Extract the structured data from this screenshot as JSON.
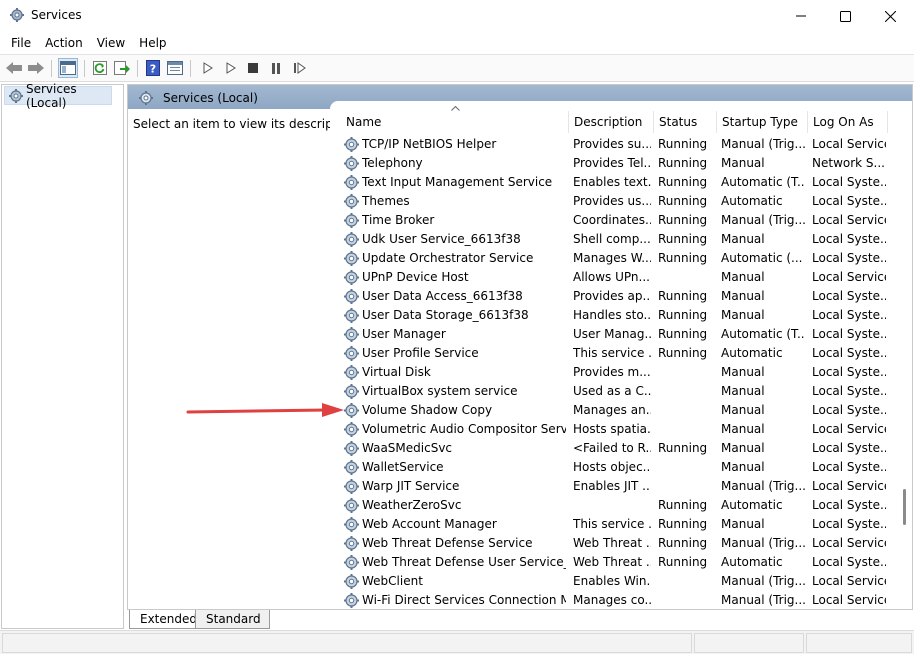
{
  "window": {
    "title": "Services",
    "minimize_icon": "minimize-icon",
    "maximize_icon": "maximize-icon",
    "close_icon": "close-icon"
  },
  "menu": [
    "File",
    "Action",
    "View",
    "Help"
  ],
  "toolbar": {
    "icons": [
      "back-icon",
      "forward-icon",
      "show-hide-console-tree-icon",
      "refresh-icon",
      "export-list-icon",
      "help-icon",
      "properties-icon",
      "start-service-icon",
      "start-service-alt-icon",
      "stop-service-icon",
      "pause-service-icon",
      "restart-service-icon"
    ]
  },
  "tree": {
    "item": "Services (Local)"
  },
  "panel": {
    "header": "Services (Local)",
    "description_hint": "Select an item to view its description."
  },
  "columns": {
    "name": "Name",
    "description": "Description",
    "status": "Status",
    "startup": "Startup Type",
    "logon": "Log On As"
  },
  "services": [
    {
      "name": "TCP/IP NetBIOS Helper",
      "description": "Provides su...",
      "status": "Running",
      "startup": "Manual (Trig...",
      "logon": "Local Service"
    },
    {
      "name": "Telephony",
      "description": "Provides Tel...",
      "status": "Running",
      "startup": "Manual",
      "logon": "Network S..."
    },
    {
      "name": "Text Input Management Service",
      "description": "Enables text...",
      "status": "Running",
      "startup": "Automatic (T...",
      "logon": "Local Syste..."
    },
    {
      "name": "Themes",
      "description": "Provides us...",
      "status": "Running",
      "startup": "Automatic",
      "logon": "Local Syste..."
    },
    {
      "name": "Time Broker",
      "description": "Coordinates...",
      "status": "Running",
      "startup": "Manual (Trig...",
      "logon": "Local Service"
    },
    {
      "name": "Udk User Service_6613f38",
      "description": "Shell comp...",
      "status": "Running",
      "startup": "Manual",
      "logon": "Local Syste..."
    },
    {
      "name": "Update Orchestrator Service",
      "description": "Manages W...",
      "status": "Running",
      "startup": "Automatic (...",
      "logon": "Local Syste..."
    },
    {
      "name": "UPnP Device Host",
      "description": "Allows UPn...",
      "status": "",
      "startup": "Manual",
      "logon": "Local Service"
    },
    {
      "name": "User Data Access_6613f38",
      "description": "Provides ap...",
      "status": "Running",
      "startup": "Manual",
      "logon": "Local Syste..."
    },
    {
      "name": "User Data Storage_6613f38",
      "description": "Handles sto...",
      "status": "Running",
      "startup": "Manual",
      "logon": "Local Syste..."
    },
    {
      "name": "User Manager",
      "description": "User Manag...",
      "status": "Running",
      "startup": "Automatic (T...",
      "logon": "Local Syste..."
    },
    {
      "name": "User Profile Service",
      "description": "This service ...",
      "status": "Running",
      "startup": "Automatic",
      "logon": "Local Syste..."
    },
    {
      "name": "Virtual Disk",
      "description": "Provides m...",
      "status": "",
      "startup": "Manual",
      "logon": "Local Syste..."
    },
    {
      "name": "VirtualBox system service",
      "description": "Used as a C...",
      "status": "",
      "startup": "Manual",
      "logon": "Local Syste..."
    },
    {
      "name": "Volume Shadow Copy",
      "description": "Manages an...",
      "status": "",
      "startup": "Manual",
      "logon": "Local Syste..."
    },
    {
      "name": "Volumetric Audio Compositor Service",
      "description": "Hosts spatia...",
      "status": "",
      "startup": "Manual",
      "logon": "Local Service"
    },
    {
      "name": "WaaSMedicSvc",
      "description": "<Failed to R...",
      "status": "Running",
      "startup": "Manual",
      "logon": "Local Syste..."
    },
    {
      "name": "WalletService",
      "description": "Hosts objec...",
      "status": "",
      "startup": "Manual",
      "logon": "Local Syste..."
    },
    {
      "name": "Warp JIT Service",
      "description": "Enables JIT ...",
      "status": "",
      "startup": "Manual (Trig...",
      "logon": "Local Service"
    },
    {
      "name": "WeatherZeroSvc",
      "description": "",
      "status": "Running",
      "startup": "Automatic",
      "logon": "Local Syste..."
    },
    {
      "name": "Web Account Manager",
      "description": "This service ...",
      "status": "Running",
      "startup": "Manual",
      "logon": "Local Syste..."
    },
    {
      "name": "Web Threat Defense Service",
      "description": "Web Threat ...",
      "status": "Running",
      "startup": "Manual (Trig...",
      "logon": "Local Service"
    },
    {
      "name": "Web Threat Defense User Service_661...",
      "description": "Web Threat ...",
      "status": "Running",
      "startup": "Automatic",
      "logon": "Local Syste..."
    },
    {
      "name": "WebClient",
      "description": "Enables Win...",
      "status": "",
      "startup": "Manual (Trig...",
      "logon": "Local Service"
    },
    {
      "name": "Wi-Fi Direct Services Connection Ma...",
      "description": "Manages co...",
      "status": "",
      "startup": "Manual (Trig...",
      "logon": "Local Service"
    }
  ],
  "tabs": [
    "Extended",
    "Standard"
  ],
  "colors": {
    "annotation_arrow": "#e04040",
    "panel_header": "#9db3cc",
    "selection": "#dde8f4"
  }
}
